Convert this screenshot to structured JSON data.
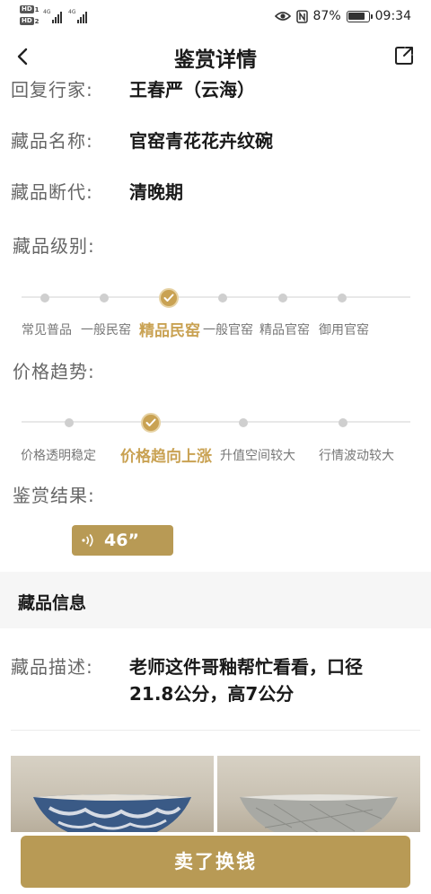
{
  "status_bar": {
    "sim1_label": "HD",
    "sim1_num": "1",
    "sim2_label": "HD",
    "sim2_num": "2",
    "net1": "4G",
    "net2": "4G",
    "battery_percent": "87%",
    "battery_level": 0.87,
    "time": "09:34",
    "icons": [
      "eye-icon",
      "nfc-icon",
      "battery-icon"
    ]
  },
  "nav": {
    "title": "鉴赏详情",
    "back_icon": "chevron-left-icon",
    "share_icon": "share-icon"
  },
  "info": {
    "expert_label": "回复行家:",
    "expert_value": "王春严（云海）",
    "name_label": "藏品名称:",
    "name_value": "官窑青花花卉纹碗",
    "period_label": "藏品断代:",
    "period_value": "清晚期",
    "grade_label": "藏品级别:",
    "trend_label": "价格趋势:",
    "result_label": "鉴赏结果:"
  },
  "grade_scale": {
    "options": [
      "常见普品",
      "一般民窑",
      "精品民窑",
      "一般官窑",
      "精品官窑",
      "御用官窑"
    ],
    "selected_index": 2
  },
  "trend_scale": {
    "options": [
      "价格透明稳定",
      "价格趋向上涨",
      "升值空间较大",
      "行情波动较大"
    ],
    "selected_index": 1
  },
  "audio": {
    "duration": "46”",
    "icon": "sound-wave-icon"
  },
  "collection_section": {
    "title": "藏品信息",
    "desc_label": "藏品描述:",
    "desc_value": "老师这件哥釉帮忙看看，口径21.8公分，高7公分"
  },
  "photos": [
    "bowl-photo-1",
    "bowl-photo-2"
  ],
  "colors": {
    "accent": "#c9a253",
    "button": "#b89a55",
    "band": "#f6f6f6"
  },
  "bottom_button": {
    "label": "卖了换钱"
  }
}
